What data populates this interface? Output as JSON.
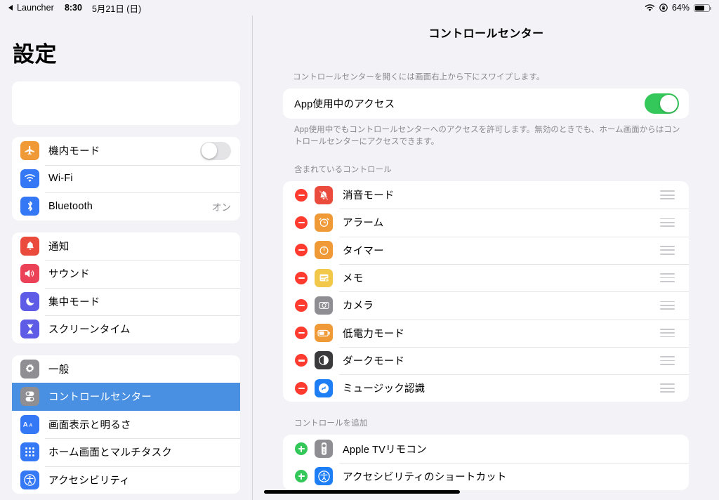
{
  "statusbar": {
    "back_label": "Launcher",
    "time": "8:30",
    "date": "5月21日 (日)",
    "battery_percent": "64%",
    "battery_level": 64,
    "wifi_icon": "wifi-icon",
    "rotation_lock_icon": "rotation-lock-icon",
    "battery_icon": "battery-icon"
  },
  "sidebar": {
    "title": "設定",
    "groups": [
      {
        "items": [
          {
            "label": "機内モード",
            "icon": "airplane-icon",
            "icon_color": "#f09a37",
            "accessory": "toggle",
            "toggle_on": false
          },
          {
            "label": "Wi-Fi",
            "icon": "wifi-icon",
            "icon_color": "#3478f6",
            "accessory": "none"
          },
          {
            "label": "Bluetooth",
            "icon": "bluetooth-icon",
            "icon_color": "#3478f6",
            "accessory": "value",
            "value": "オン"
          }
        ]
      },
      {
        "items": [
          {
            "label": "通知",
            "icon": "bell-icon",
            "icon_color": "#eb4b3c",
            "accessory": "none"
          },
          {
            "label": "サウンド",
            "icon": "speaker-icon",
            "icon_color": "#ec4257",
            "accessory": "none"
          },
          {
            "label": "集中モード",
            "icon": "moon-icon",
            "icon_color": "#5e5ce6",
            "accessory": "none"
          },
          {
            "label": "スクリーンタイム",
            "icon": "hourglass-icon",
            "icon_color": "#5e5ce6",
            "accessory": "none"
          }
        ]
      },
      {
        "items": [
          {
            "label": "一般",
            "icon": "gear-icon",
            "icon_color": "#8e8e93",
            "accessory": "none"
          },
          {
            "label": "コントロールセンター",
            "icon": "control-center-icon",
            "icon_color": "#8e8e93",
            "accessory": "none",
            "selected": true
          },
          {
            "label": "画面表示と明るさ",
            "icon": "text-size-icon",
            "icon_color": "#3478f6",
            "accessory": "none"
          },
          {
            "label": "ホーム画面とマルチタスク",
            "icon": "home-screen-icon",
            "icon_color": "#3478f6",
            "accessory": "none"
          },
          {
            "label": "アクセシビリティ",
            "icon": "accessibility-icon",
            "icon_color": "#3478f6",
            "accessory": "none"
          }
        ]
      }
    ]
  },
  "detail": {
    "title": "コントロールセンター",
    "hint": "コントロールセンターを開くには画面右上から下にスワイプします。",
    "access_toggle": {
      "label": "App使用中のアクセス",
      "on": true
    },
    "access_description": "App使用中でもコントロールセンターへのアクセスを許可します。無効のときでも、ホーム画面からはコントロールセンターにアクセスできます。",
    "included_section_header": "含まれているコントロール",
    "included_controls": [
      {
        "label": "消音モード",
        "icon": "bell-slash-icon",
        "icon_color": "#eb4b3c",
        "action": "remove"
      },
      {
        "label": "アラーム",
        "icon": "alarm-clock-icon",
        "icon_color": "#f09a37",
        "action": "remove"
      },
      {
        "label": "タイマー",
        "icon": "timer-icon",
        "icon_color": "#f09a37",
        "action": "remove"
      },
      {
        "label": "メモ",
        "icon": "notes-icon",
        "icon_color": "#f2c84b",
        "action": "remove"
      },
      {
        "label": "カメラ",
        "icon": "camera-icon",
        "icon_color": "#8e8e93",
        "action": "remove"
      },
      {
        "label": "低電力モード",
        "icon": "low-power-battery-icon",
        "icon_color": "#f09a37",
        "action": "remove"
      },
      {
        "label": "ダークモード",
        "icon": "dark-mode-icon",
        "icon_color": "#3a3a3c",
        "action": "remove"
      },
      {
        "label": "ミュージック認識",
        "icon": "shazam-icon",
        "icon_color": "#1d7ef5",
        "action": "remove"
      }
    ],
    "add_section_header": "コントロールを追加",
    "add_controls": [
      {
        "label": "Apple TVリモコン",
        "icon": "apple-tv-remote-icon",
        "icon_color": "#8e8e93",
        "action": "add"
      },
      {
        "label": "アクセシビリティのショートカット",
        "icon": "accessibility-icon",
        "icon_color": "#1d7ef5",
        "action": "add"
      }
    ]
  },
  "colors": {
    "accent_blue": "#4a90e2",
    "toggle_on_green": "#34c759",
    "remove_red": "#ff3b30",
    "add_green": "#34c759",
    "background": "#f2f2f7",
    "card": "#ffffff",
    "secondary_text": "#8a8a8e"
  }
}
